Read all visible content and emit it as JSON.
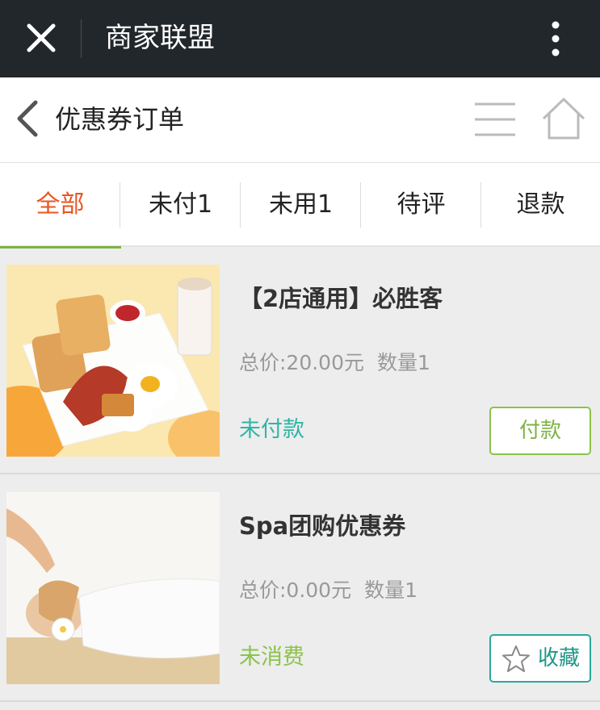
{
  "window": {
    "title": "商家联盟"
  },
  "header": {
    "title": "优惠券订单"
  },
  "tabs": [
    {
      "label": "全部",
      "active": true
    },
    {
      "label": "未付1"
    },
    {
      "label": "未用1"
    },
    {
      "label": "待评"
    },
    {
      "label": "退款"
    }
  ],
  "orders": [
    {
      "name": "【2店通用】必胜客",
      "total": "总价:20.00元",
      "qty": "数量1",
      "status": "未付款",
      "status_color": "#2fb5a5",
      "action": "付款"
    },
    {
      "name": "Spa团购优惠券",
      "total": "总价:0.00元",
      "qty": "数量1",
      "status": "未消费",
      "status_color": "#8bc34a",
      "action": "收藏"
    }
  ],
  "colors": {
    "active_tab": "#ea5520",
    "tab_indicator": "#7cb342",
    "titlebar": "#22272b"
  }
}
